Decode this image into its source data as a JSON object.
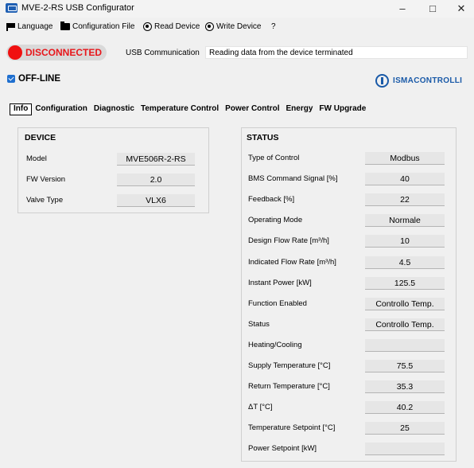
{
  "window": {
    "title": "MVE-2-RS USB Configurator"
  },
  "menu": {
    "language": "Language",
    "config_file": "Configuration File",
    "read_device": "Read Device",
    "write_device": "Write Device",
    "help": "?"
  },
  "status_bar": {
    "connection": "DISCONNECTED",
    "usb_label": "USB Communication",
    "usb_value": "Reading data from the device terminated",
    "offline_label": "OFF-LINE",
    "offline_checked": true
  },
  "logo": {
    "text": "ISMACONTROLLI",
    "color": "#1a5aa8"
  },
  "tabs": [
    "Info",
    "Configuration",
    "Diagnostic",
    "Temperature Control",
    "Power Control",
    "Energy",
    "FW Upgrade"
  ],
  "device": {
    "title": "DEVICE",
    "rows": [
      {
        "label": "Model",
        "value": "MVE506R-2-RS"
      },
      {
        "label": "FW Version",
        "value": "2.0"
      },
      {
        "label": "Valve Type",
        "value": "VLX6"
      }
    ]
  },
  "status": {
    "title": "STATUS",
    "rows": [
      {
        "label": "Type of Control",
        "value": "Modbus"
      },
      {
        "label": "BMS Command Signal [%]",
        "value": "40"
      },
      {
        "label": "Feedback [%]",
        "value": "22"
      },
      {
        "label": "Operating Mode",
        "value": "Normale"
      },
      {
        "label": "Design Flow Rate [m³/h]",
        "value": "10"
      },
      {
        "label": "Indicated Flow Rate [m³/h]",
        "value": "4.5"
      },
      {
        "label": "Instant Power [kW]",
        "value": "125.5"
      },
      {
        "label": "Function Enabled",
        "value": "Controllo Temp."
      },
      {
        "label": "Status",
        "value": "Controllo Temp."
      },
      {
        "label": "Heating/Cooling",
        "value": ""
      },
      {
        "label": "Supply Temperature [°C]",
        "value": "75.5"
      },
      {
        "label": "Return Temperature [°C]",
        "value": "35.3"
      },
      {
        "label": "ΔT [°C]",
        "value": "40.2"
      },
      {
        "label": "Temperature Setpoint [°C]",
        "value": "25"
      },
      {
        "label": "Power Setpoint [kW]",
        "value": ""
      }
    ]
  },
  "colors": {
    "disconnected": "#e8161b",
    "accent": "#1f6fcf"
  }
}
